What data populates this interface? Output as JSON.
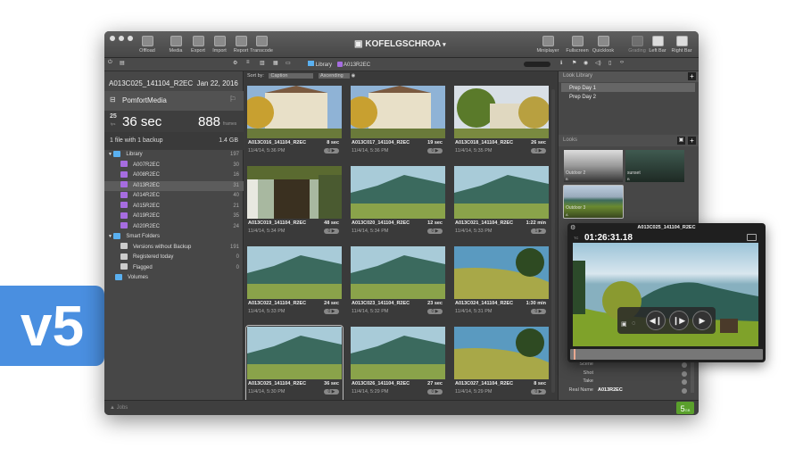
{
  "badge": "v5",
  "toolbar": {
    "title": "KOFELGSCHROA",
    "left_buttons": [
      "Offload",
      "Media",
      "Export",
      "Import",
      "Report",
      "Transcode"
    ],
    "right_buttons": [
      "Miniplayer",
      "Fullscreen",
      "Quicklook",
      "Grading",
      "Left Bar",
      "Right Bar"
    ]
  },
  "breadcrumb": {
    "library": "Library",
    "folder": "A013R2EC"
  },
  "sort": {
    "label": "Sort by:",
    "field": "Caption",
    "order": "Ascending"
  },
  "clip_info": {
    "name": "A013C025_141104_R2EC",
    "date": "Jan 22, 2016",
    "volume": "PomfortMedia",
    "fps": "25",
    "fps_unit": "fps",
    "duration": "36 sec",
    "frames": "888",
    "frames_unit": "frames",
    "backup": "1 file with 1 backup",
    "size": "1.4 GB"
  },
  "tree": [
    {
      "label": "Library",
      "count": "197",
      "type": "root"
    },
    {
      "label": "A007R2EC",
      "count": "30",
      "type": "clip"
    },
    {
      "label": "A008R2EC",
      "count": "16",
      "type": "clip"
    },
    {
      "label": "A013R2EC",
      "count": "31",
      "type": "clip",
      "selected": true
    },
    {
      "label": "A014R2EC",
      "count": "40",
      "type": "clip"
    },
    {
      "label": "A015R2EC",
      "count": "21",
      "type": "clip"
    },
    {
      "label": "A019R2EC",
      "count": "35",
      "type": "clip"
    },
    {
      "label": "A020R2EC",
      "count": "24",
      "type": "clip"
    },
    {
      "label": "Smart Folders",
      "count": "",
      "type": "root"
    },
    {
      "label": "Versions without Backup",
      "count": "191",
      "type": "smart"
    },
    {
      "label": "Registered today",
      "count": "0",
      "type": "smart"
    },
    {
      "label": "Flagged",
      "count": "0",
      "type": "smart"
    },
    {
      "label": "Volumes",
      "count": "",
      "type": "volumes"
    }
  ],
  "clips": [
    {
      "name": "A013C016_141104_R2EC",
      "dur": "8 sec",
      "date": "11/4/14, 5:36 PM",
      "n": "0",
      "scene": "building"
    },
    {
      "name": "A013C017_141104_R2EC",
      "dur": "19 sec",
      "date": "11/4/14, 5:36 PM",
      "n": "0",
      "scene": "building"
    },
    {
      "name": "A013C018_141104_R2EC",
      "dur": "26 sec",
      "date": "11/4/14, 5:35 PM",
      "n": "0",
      "scene": "house"
    },
    {
      "name": "A013C019_141104_R2EC",
      "dur": "48 sec",
      "date": "11/4/14, 5:34 PM",
      "n": "0",
      "scene": "garden"
    },
    {
      "name": "A013C020_141104_R2EC",
      "dur": "12 sec",
      "date": "11/4/14, 5:34 PM",
      "n": "0",
      "scene": "valley"
    },
    {
      "name": "A013C021_141104_R2EC",
      "dur": "1:22 min",
      "date": "11/4/14, 5:33 PM",
      "n": "1",
      "scene": "valley"
    },
    {
      "name": "A013C022_141104_R2EC",
      "dur": "24 sec",
      "date": "11/4/14, 5:33 PM",
      "n": "0",
      "scene": "valley"
    },
    {
      "name": "A013C023_141104_R2EC",
      "dur": "23 sec",
      "date": "11/4/14, 5:32 PM",
      "n": "0",
      "scene": "valley"
    },
    {
      "name": "A013C024_141104_R2EC",
      "dur": "1:30 min",
      "date": "11/4/14, 5:31 PM",
      "n": "0",
      "scene": "meadow"
    },
    {
      "name": "A013C025_141104_R2EC",
      "dur": "36 sec",
      "date": "11/4/14, 5:30 PM",
      "n": "0",
      "scene": "valley",
      "selected": true
    },
    {
      "name": "A013C026_141104_R2EC",
      "dur": "27 sec",
      "date": "11/4/14, 5:29 PM",
      "n": "0",
      "scene": "valley"
    },
    {
      "name": "A013C027_141104_R2EC",
      "dur": "8 sec",
      "date": "11/4/14, 5:29 PM",
      "n": "0",
      "scene": "meadow"
    }
  ],
  "look_library": {
    "title": "Look Library",
    "items": [
      "Prep Day 1",
      "Prep Day 2"
    ]
  },
  "looks": {
    "title": "Looks",
    "items": [
      {
        "name": "Outdoor 2",
        "tag": "B"
      },
      {
        "name": "sunset",
        "tag": "B"
      },
      {
        "name": "Outdoor 3",
        "tag": "A"
      }
    ]
  },
  "player": {
    "title": "A013C025_141104_R2EC",
    "timecode": "01:26:31.18",
    "tc_label": "TC"
  },
  "metadata": [
    {
      "label": "Scene",
      "value": ""
    },
    {
      "label": "Shot",
      "value": ""
    },
    {
      "label": "Take",
      "value": ""
    },
    {
      "label": "Real Name",
      "value": "A013R2EC"
    }
  ],
  "bottom": {
    "jobs": "Jobs",
    "count": "5",
    "count_unit": "GB"
  },
  "colors": {
    "accent": "#4a8fe0",
    "clip_folder": "#a66de0",
    "status_green": "#5aa02c"
  }
}
